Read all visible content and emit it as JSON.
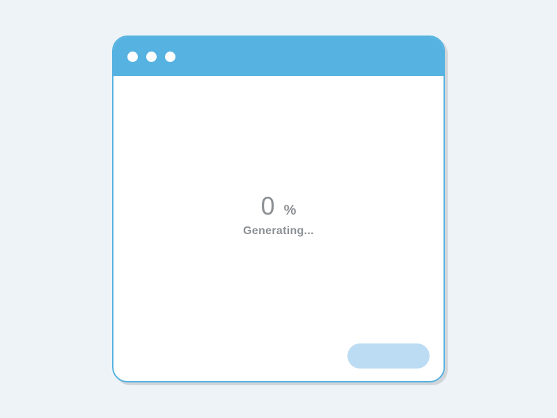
{
  "progress": {
    "value": "0",
    "unit": "%",
    "status": "Generating..."
  },
  "button": {
    "label": ""
  },
  "colors": {
    "accent": "#55b2e1",
    "button_bg": "#bcdcf3",
    "text_muted": "#8b8f93",
    "background": "#eef3f7"
  }
}
